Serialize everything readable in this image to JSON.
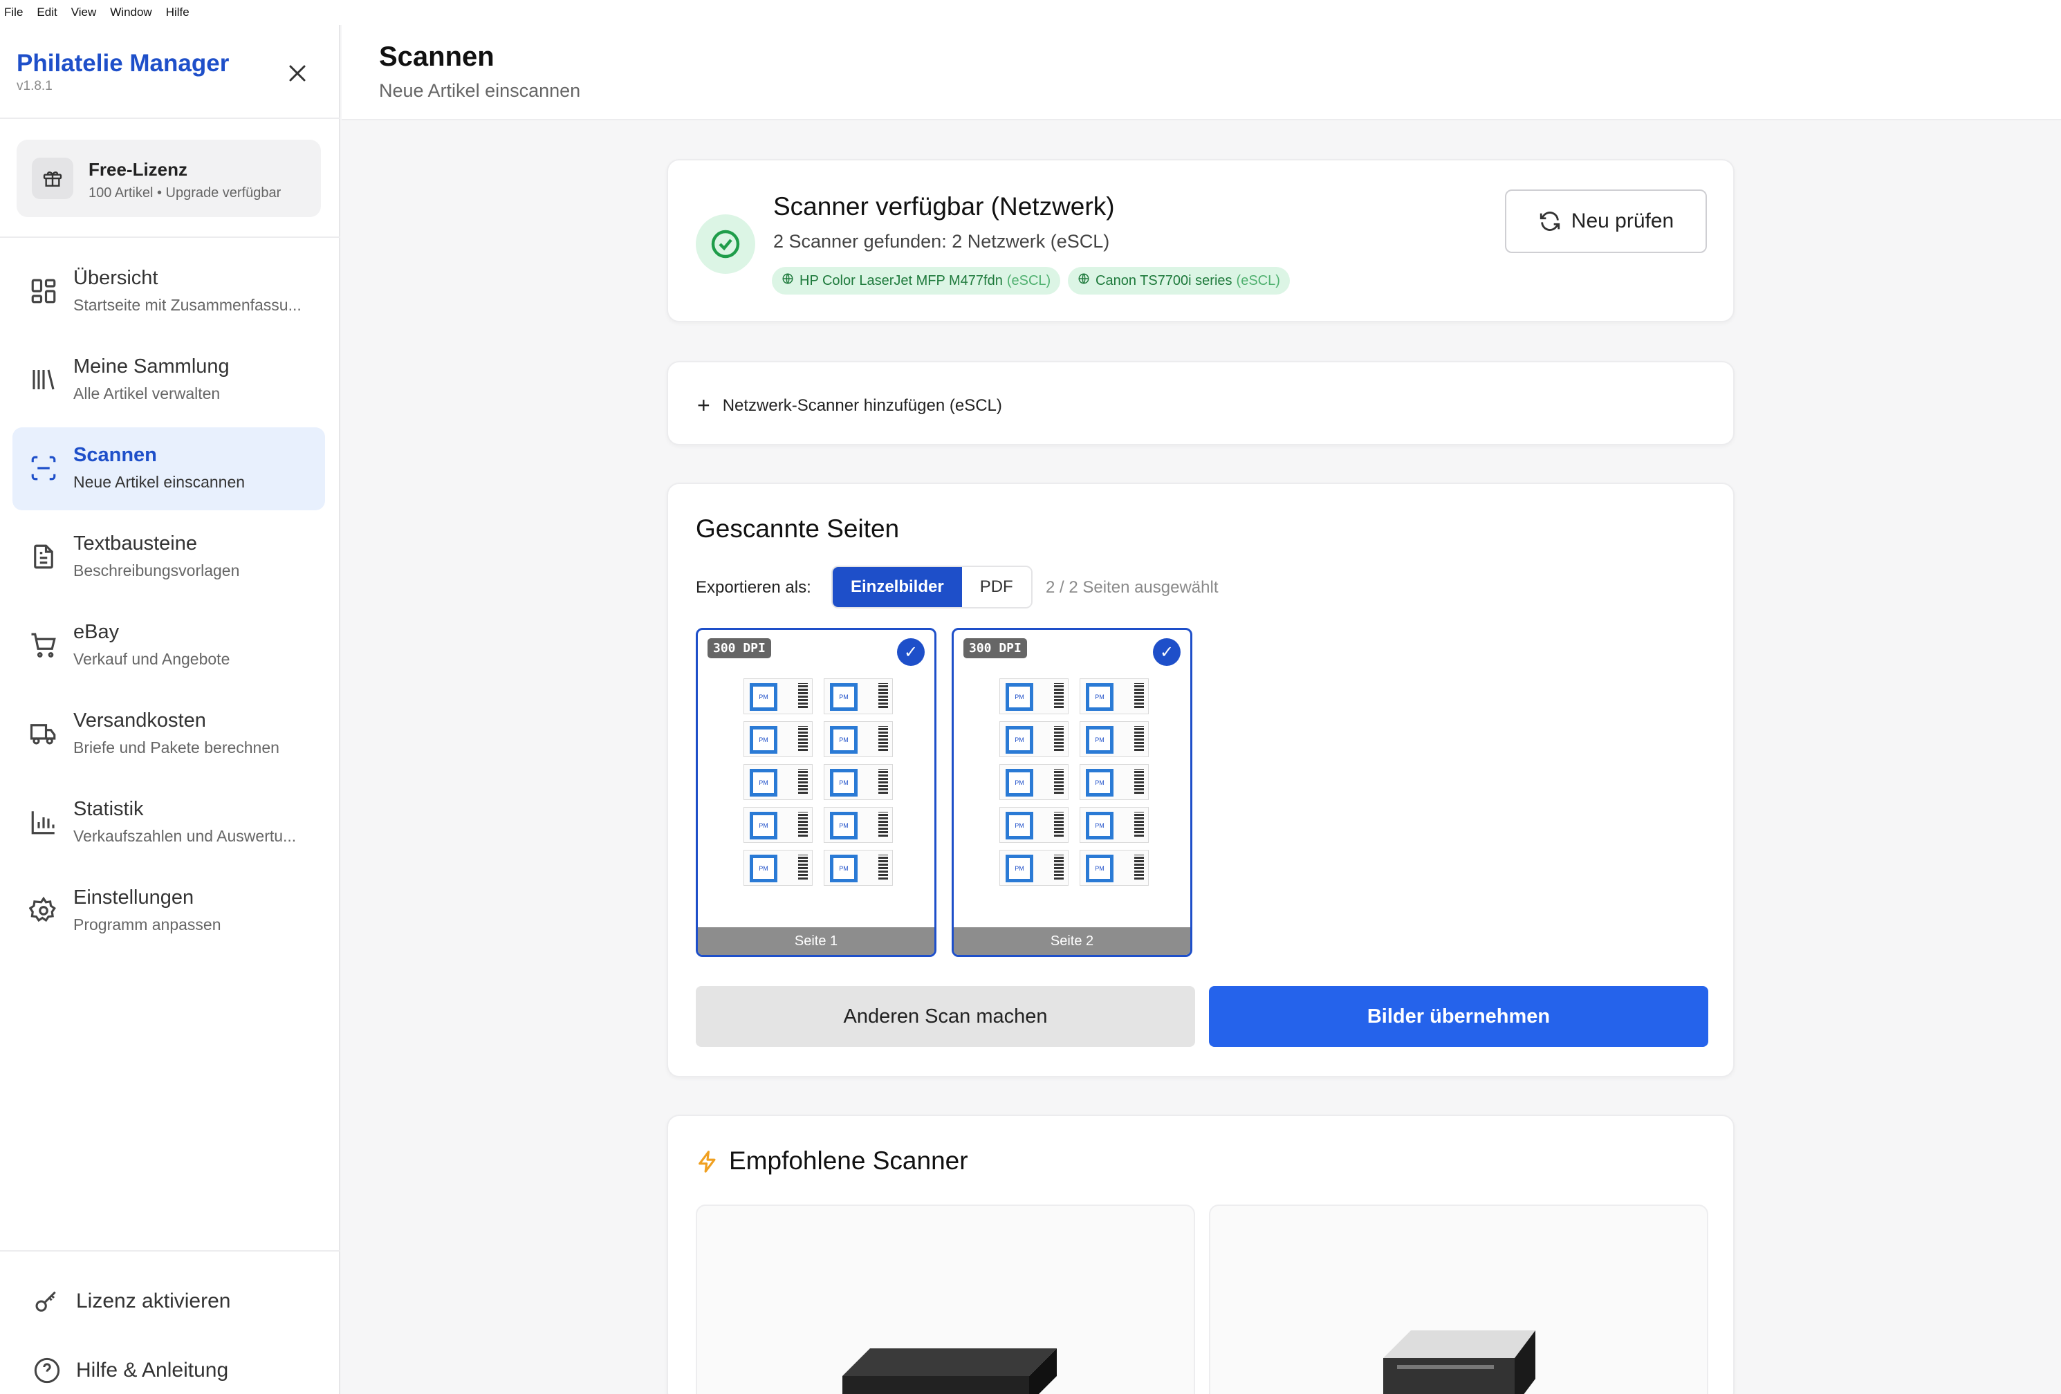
{
  "menubar": {
    "items": [
      "File",
      "Edit",
      "View",
      "Window",
      "Hilfe"
    ]
  },
  "sidebar": {
    "brand_title": "Philatelie Manager",
    "version": "v1.8.1",
    "license": {
      "title": "Free-Lizenz",
      "subtitle": "100 Artikel • Upgrade verfügbar"
    },
    "items": [
      {
        "label": "Übersicht",
        "sub": "Startseite mit Zusammenfassu...",
        "icon": "grid-icon"
      },
      {
        "label": "Meine Sammlung",
        "sub": "Alle Artikel verwalten",
        "icon": "library-icon"
      },
      {
        "label": "Scannen",
        "sub": "Neue Artikel einscannen",
        "icon": "scan-icon"
      },
      {
        "label": "Textbausteine",
        "sub": "Beschreibungsvorlagen",
        "icon": "document-icon"
      },
      {
        "label": "eBay",
        "sub": "Verkauf und Angebote",
        "icon": "cart-icon"
      },
      {
        "label": "Versandkosten",
        "sub": "Briefe und Pakete berechnen",
        "icon": "truck-icon"
      },
      {
        "label": "Statistik",
        "sub": "Verkaufszahlen und Auswertu...",
        "icon": "chart-icon"
      },
      {
        "label": "Einstellungen",
        "sub": "Programm anpassen",
        "icon": "gear-icon"
      }
    ],
    "footer": {
      "activate": "Lizenz aktivieren",
      "help": "Hilfe & Anleitung"
    }
  },
  "header": {
    "title": "Scannen",
    "subtitle": "Neue Artikel einscannen"
  },
  "scanner_status": {
    "title": "Scanner verfügbar (Netzwerk)",
    "subtitle": "2 Scanner gefunden: 2 Netzwerk (eSCL)",
    "chips": [
      {
        "name": "HP Color LaserJet MFP M477fdn",
        "proto": "(eSCL)"
      },
      {
        "name": "Canon TS7700i series",
        "proto": "(eSCL)"
      }
    ],
    "recheck_label": "Neu prüfen"
  },
  "add_scanner": {
    "label": "Netzwerk-Scanner hinzufügen (eSCL)"
  },
  "scanned": {
    "title": "Gescannte Seiten",
    "export_label": "Exportieren als:",
    "export_options": [
      "Einzelbilder",
      "PDF"
    ],
    "selected_count": "2 / 2 Seiten ausgewählt",
    "pages": [
      {
        "dpi": "300 DPI",
        "label": "Seite 1"
      },
      {
        "dpi": "300 DPI",
        "label": "Seite 2"
      }
    ],
    "stamp_label": "PM",
    "btn_rescan": "Anderen Scan machen",
    "btn_accept": "Bilder übernehmen"
  },
  "recommended": {
    "title": "Empfohlene Scanner"
  }
}
